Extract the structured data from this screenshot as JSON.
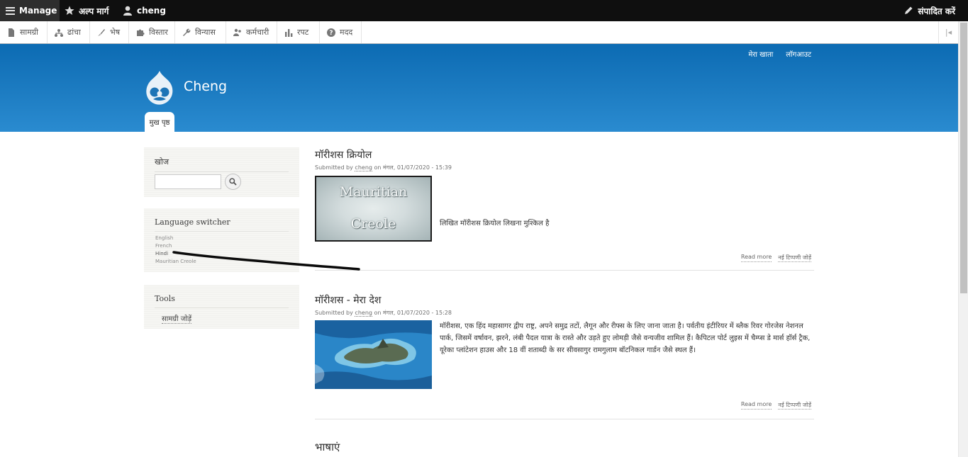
{
  "toolbar": {
    "manage_label": "Manage",
    "shortcuts_label": "अल्प मार्ग",
    "user_label": "cheng",
    "edit_label": "संपादित करें"
  },
  "admin_menu": {
    "items": [
      {
        "label": "सामग्री",
        "icon": "file-icon"
      },
      {
        "label": "ढांचा",
        "icon": "structure-icon"
      },
      {
        "label": "भेष",
        "icon": "paintbrush-icon"
      },
      {
        "label": "विस्तार",
        "icon": "puzzle-icon"
      },
      {
        "label": "विन्यास",
        "icon": "wrench-icon"
      },
      {
        "label": "कर्मचारी",
        "icon": "people-icon"
      },
      {
        "label": "रपट",
        "icon": "bar-chart-icon"
      },
      {
        "label": "मदद",
        "icon": "help-icon"
      }
    ]
  },
  "header": {
    "site_name": "Cheng",
    "account_link": "मेरा खाता",
    "logout_link": "लॉगआउट",
    "home_tab": "मुख पृष्ठ"
  },
  "sidebar": {
    "search_title": "खोज",
    "language_title": "Language switcher",
    "languages": [
      "English",
      "French",
      "Hindi",
      "Mauritian Creole"
    ],
    "active_language": "Hindi",
    "tools_title": "Tools",
    "tools_link": "सामग्री जोड़ें"
  },
  "articles": [
    {
      "title": "मॉरीशस क्रियोल",
      "submitted_prefix": "Submitted by",
      "author": "cheng",
      "date_text": "on मंगल, 01/07/2020 - 15:39",
      "image_caption_1": "Mauritian",
      "image_caption_2": "Creole",
      "body": "लिखित मॉरीशस क्रियोल लिखना मुश्किल है",
      "read_more": "Read more",
      "add_comment": "नई टिप्पणी जोड़ें"
    },
    {
      "title": "मॉरीशस - मेरा देश",
      "submitted_prefix": "Submitted by",
      "author": "cheng",
      "date_text": "on मंगल, 01/07/2020 - 15:28",
      "body": "मॉरीशस, एक हिंद महासागर द्वीप राष्ट्र, अपने समुद्र तटों, लैगून और रीफ्स के लिए जाना जाता है। पर्वतीय इंटीरियर में ब्लैक रिवर गोरजेस नेशनल पार्क, जिसमें वर्षावन, झरने, लंबी पैदल यात्रा के रास्ते और उड़ते हुए लोमड़ी जैसे वन्यजीव शामिल हैं। कैपिटल पोर्ट लुइस में चैम्प्स डे मार्स हॉर्स ट्रैक, यूरेका प्लांटेशन हाउस और 18 वीं शताब्दी के सर सीवसागुर रामगुलाम बॉटनिकल गार्डन जैसे स्थल हैं।",
      "read_more": "Read more",
      "add_comment": "नई टिप्पणी जोड़ें"
    }
  ],
  "languages_heading": "भाषाएं",
  "colors": {
    "toolbar_bg": "#0f0f0f",
    "header_blue": "#1a79bf",
    "sidebar_bg": "#f6f6f3"
  }
}
